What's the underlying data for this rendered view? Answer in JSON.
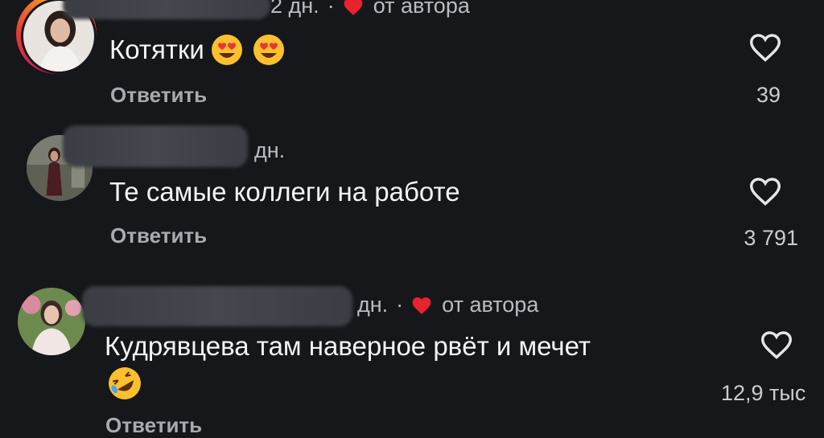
{
  "comments": [
    {
      "time": "2 дн.",
      "author_liked_label": "от автора",
      "text": "Котятки",
      "reply_label": "Ответить",
      "likes": "39",
      "emojis": [
        "heart-eyes-emoji",
        "heart-eyes-emoji"
      ]
    },
    {
      "time": "дн.",
      "text": "Те самые коллеги на работе",
      "reply_label": "Ответить",
      "likes": "3 791"
    },
    {
      "time": "дн.",
      "author_liked_label": "от автора",
      "text": "Кудрявцева там наверное рвёт и мечет",
      "reply_label": "Ответить",
      "likes": "12,9 тыс",
      "emojis": [
        "rofl-emoji"
      ]
    }
  ],
  "colors": {
    "background": "#16171b",
    "heart_red": "#e8222f",
    "story_ring": "#e53935"
  }
}
